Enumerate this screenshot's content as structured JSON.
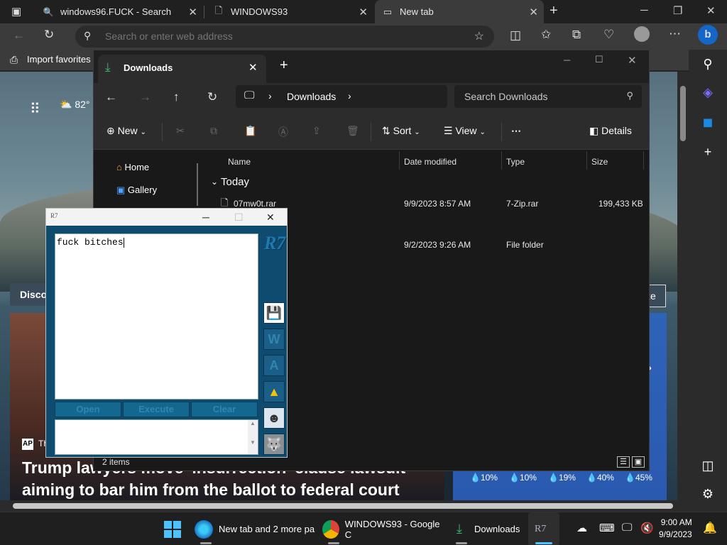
{
  "browser": {
    "tabs": [
      {
        "title": "windows96.FUCK - Search",
        "icon": "search-icon"
      },
      {
        "title": "WINDOWS93",
        "icon": "page-icon"
      },
      {
        "title": "New tab",
        "icon": "newtab-icon"
      }
    ],
    "address_placeholder": "Search or enter web address",
    "favorites": {
      "import_label": "Import favorites"
    }
  },
  "newtab": {
    "temperature": "82°",
    "discover_label": "Discov",
    "customize_label": "ze",
    "news": {
      "source_badge": "AP",
      "source_name": "Th",
      "headline": "Trump lawyers move 'insurrection' clause lawsuit aiming to bar him from the ballot to federal court"
    },
    "precip": [
      "10%",
      "10%",
      "19%",
      "40%",
      "45%"
    ]
  },
  "explorer": {
    "tab_title": "Downloads",
    "breadcrumb": "Downloads",
    "search_placeholder": "Search Downloads",
    "commands": {
      "new": "New",
      "sort": "Sort",
      "view": "View",
      "details": "Details"
    },
    "nav": [
      {
        "label": "Home"
      },
      {
        "label": "Gallery"
      }
    ],
    "columns": [
      "Name",
      "Date modified",
      "Type",
      "Size"
    ],
    "group": "Today",
    "files": [
      {
        "name": "07mw0t.rar",
        "date": "9/9/2023 8:57 AM",
        "type": "7-Zip.rar",
        "size": "199,433 KB"
      },
      {
        "name": "",
        "date": "9/2/2023 9:26 AM",
        "type": "File folder",
        "size": ""
      }
    ],
    "status": "2 items"
  },
  "r7": {
    "title_logo": "R7",
    "editor_text": "fuck bitches",
    "buttons": [
      "Open",
      "Execute",
      "Clear"
    ],
    "brand": "R7",
    "side_icons": [
      "save-icon",
      "w-icon",
      "a-icon",
      "drive-icon",
      "avatar-icon",
      "wolf-icon"
    ],
    "side_labels": {
      "w": "W",
      "a": "A"
    }
  },
  "taskbar": {
    "items": [
      {
        "label": "New tab and 2 more pa"
      },
      {
        "label": "WINDOWS93 - Google C"
      },
      {
        "label": "Downloads"
      },
      {
        "label": "R7"
      }
    ],
    "time": "9:00 AM",
    "date": "9/9/2023"
  },
  "colors": {
    "accent": "#2a5ab0",
    "r7_blue": "#0f4b6e",
    "explorer_bg": "#191919",
    "download_green": "#3cb371"
  }
}
